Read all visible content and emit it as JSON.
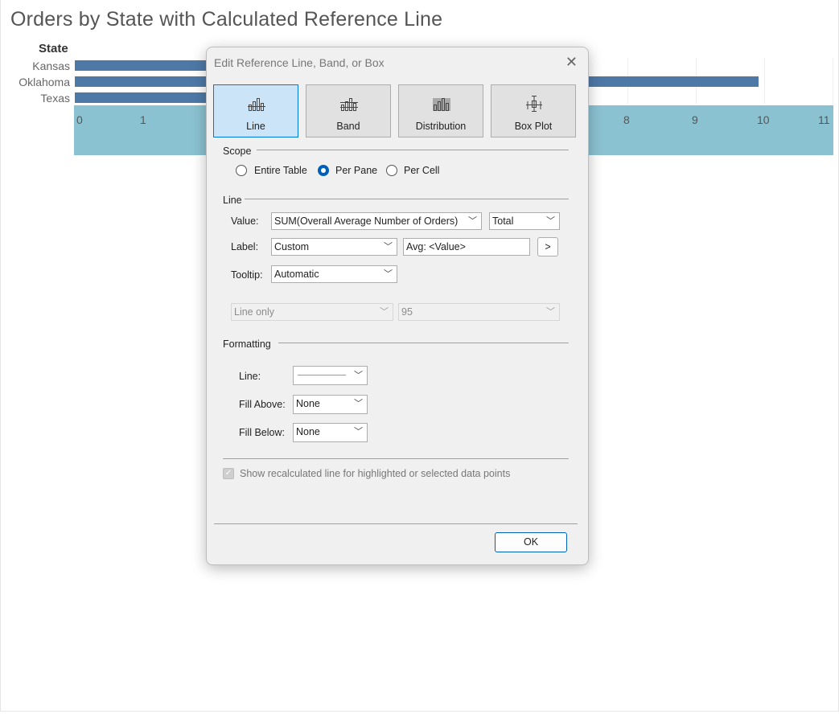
{
  "sheet": {
    "title": "Orders by State with Calculated Reference Line",
    "row_header": "State"
  },
  "chart_data": {
    "type": "bar",
    "categories": [
      "Kansas",
      "Oklahoma",
      "Texas"
    ],
    "values": [
      null,
      10,
      null
    ],
    "xlim": [
      0,
      11
    ],
    "x_ticks": [
      "0",
      "1",
      "8",
      "9",
      "10",
      "11"
    ],
    "ylabel": "State",
    "colors": {
      "bar": "#4e79a7",
      "axis_highlight": "#8bc2d1"
    }
  },
  "dialog": {
    "title": "Edit Reference Line, Band, or Box",
    "close_glyph": "✕",
    "types": [
      {
        "label": "Line",
        "icon": "line-chart-icon",
        "active": true
      },
      {
        "label": "Band",
        "icon": "band-chart-icon",
        "active": false
      },
      {
        "label": "Distribution",
        "icon": "distribution-chart-icon",
        "active": false
      },
      {
        "label": "Box Plot",
        "icon": "box-plot-icon",
        "active": false
      }
    ],
    "scope": {
      "heading": "Scope",
      "options": [
        {
          "label": "Entire Table",
          "checked": false
        },
        {
          "label": "Per Pane",
          "checked": true
        },
        {
          "label": "Per Cell",
          "checked": false
        }
      ]
    },
    "line": {
      "heading": "Line",
      "value_label": "Value:",
      "value_field": "SUM(Overall Average Number of Orders)",
      "value_agg": "Total",
      "label_label": "Label:",
      "label_mode": "Custom",
      "label_text": "Avg: <Value>",
      "label_insert_button": ">",
      "tooltip_label": "Tooltip:",
      "tooltip_mode": "Automatic",
      "ci_mode": "Line only",
      "ci_value": "95"
    },
    "formatting": {
      "heading": "Formatting",
      "line_label": "Line:",
      "fill_above_label": "Fill Above:",
      "fill_above_value": "None",
      "fill_below_label": "Fill Below:",
      "fill_below_value": "None"
    },
    "recalc_checkbox": {
      "label": "Show recalculated line for highlighted or selected data points",
      "checked": true
    },
    "ok_label": "OK"
  }
}
